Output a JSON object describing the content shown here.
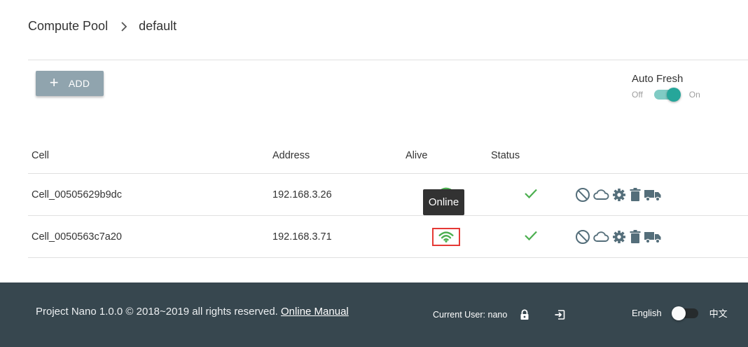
{
  "breadcrumb": {
    "root": "Compute Pool",
    "current": "default"
  },
  "toolbar": {
    "add_label": "ADD",
    "add_icon": "plus-icon"
  },
  "auto_fresh": {
    "title": "Auto Fresh",
    "off_label": "Off",
    "on_label": "On",
    "enabled": true
  },
  "table": {
    "headers": {
      "cell": "Cell",
      "address": "Address",
      "alive": "Alive",
      "status": "Status"
    },
    "rows": [
      {
        "cell": "Cell_00505629b9dc",
        "address": "192.168.3.26",
        "alive": "online",
        "status": "ok"
      },
      {
        "cell": "Cell_0050563c7a20",
        "address": "192.168.3.71",
        "alive": "online",
        "status": "ok"
      }
    ],
    "row_actions": [
      "disable-icon",
      "cloud-icon",
      "gear-icon",
      "trash-icon",
      "truck-icon"
    ]
  },
  "tooltip": {
    "text": "Online"
  },
  "footer": {
    "copyright": "Project Nano 1.0.0 © 2018~2019 all rights reserved.",
    "manual_link": "Online Manual",
    "current_user": "Current User: nano",
    "lang_left": "English",
    "lang_right": "中文"
  },
  "colors": {
    "accent": "#26a69a",
    "accent_track": "#80cbc4",
    "button": "#90a4ae",
    "online_green": "#4caf50",
    "icon_gray": "#546e7a",
    "footer_bg": "#37474f",
    "highlight_border": "#e53935"
  }
}
